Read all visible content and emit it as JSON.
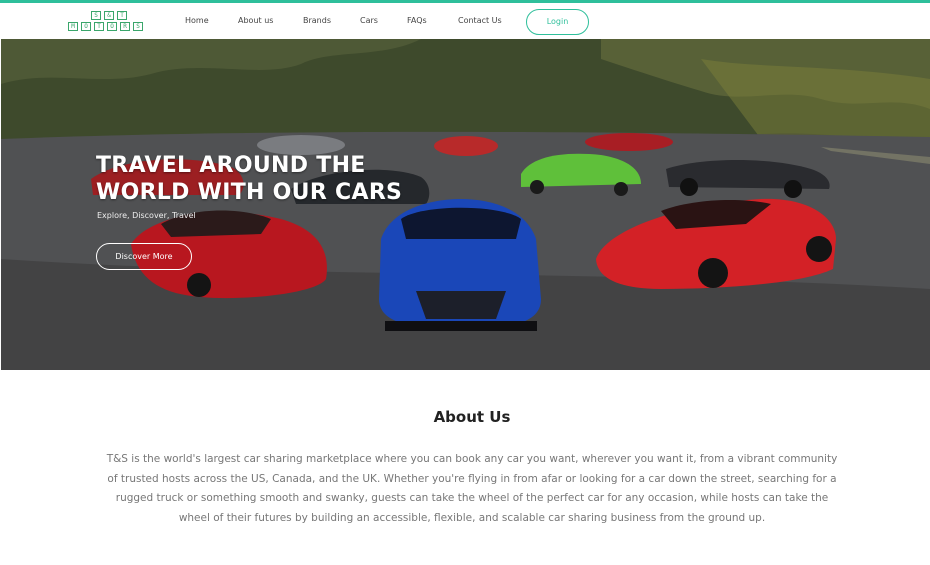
{
  "brand": {
    "logo_row1": [
      "S",
      "&",
      "T"
    ],
    "logo_row2": [
      "M",
      "O",
      "T",
      "O",
      "R",
      "S"
    ]
  },
  "nav": {
    "items": [
      {
        "label": "Home"
      },
      {
        "label": "About us"
      },
      {
        "label": "Brands"
      },
      {
        "label": "Cars"
      },
      {
        "label": "FAQs"
      },
      {
        "label": "Contact Us"
      }
    ],
    "login_label": "Login",
    "accent_color": "#2fbf9b"
  },
  "hero": {
    "title_line1": "TRAVEL AROUND THE",
    "title_line2": "WORLD WITH OUR CARS",
    "subtitle": "Explore, Discover, Travel",
    "cta_label": "Discover More"
  },
  "about": {
    "title": "About Us",
    "body": "T&S is the world's largest car sharing marketplace where you can book any car you want, wherever you want it, from a vibrant community of trusted hosts across the US, Canada, and the UK. Whether you're flying in from afar or looking for a car down the street, searching for a rugged truck or something smooth and swanky, guests can take the wheel of the perfect car for any occasion, while hosts can take the wheel of their futures by building an accessible, flexible, and scalable car sharing business from the ground up."
  }
}
